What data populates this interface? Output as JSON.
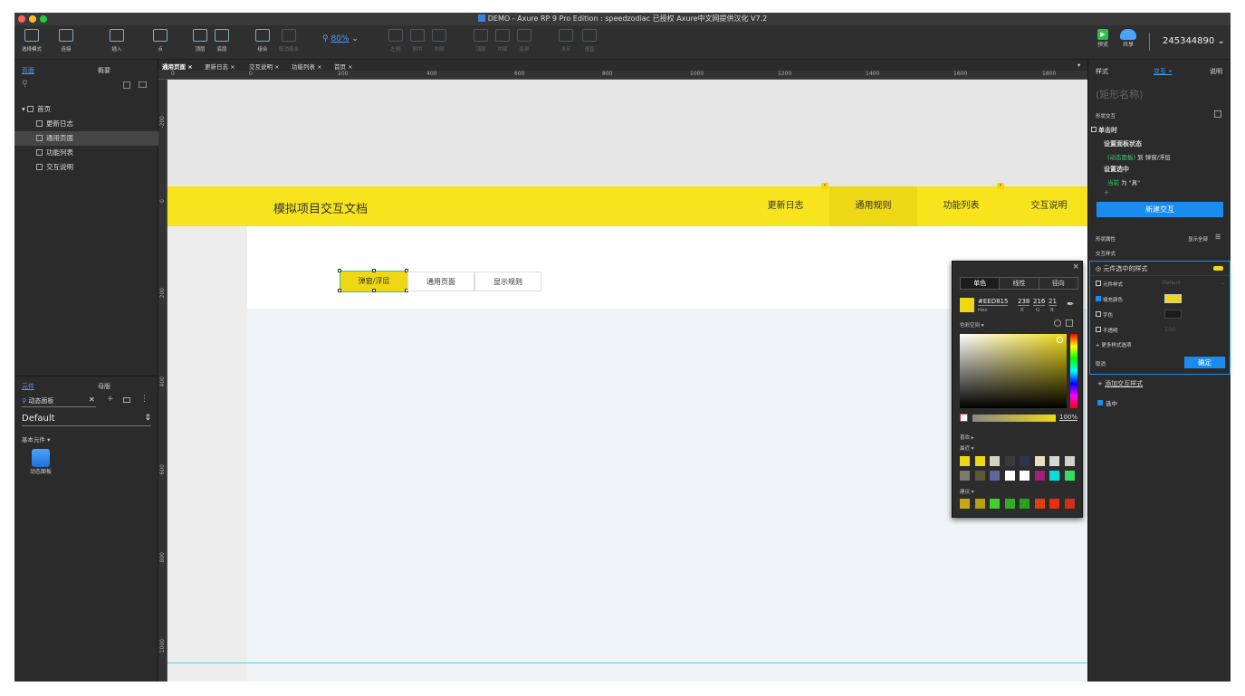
{
  "window": {
    "title": "DEMO - Axure RP 9 Pro Edition : speedzodiac 已授权    Axure中文网提供汉化 V7.2"
  },
  "toolbar": {
    "items": [
      "选择模式",
      "连接",
      "插入",
      "点",
      "顶层",
      "底层",
      "组合",
      "取消组合"
    ],
    "zoom": "80%",
    "disabled_items": [
      "左侧",
      "居中",
      "右侧",
      "顶部",
      "中部",
      "底部",
      "水平",
      "垂直"
    ],
    "preview": "预览",
    "share": "共享",
    "account": "245344890"
  },
  "left_panel": {
    "tabs": [
      "页面",
      "概要"
    ],
    "tree": {
      "root": "首页",
      "children": [
        "更新日志",
        "通用页面",
        "功能列表",
        "交互说明"
      ]
    },
    "lib_tabs": [
      "元件",
      "母版"
    ],
    "search_value": "动态面板",
    "library": "Default",
    "section": "基本元件 ▾",
    "widget_label": "动态面板"
  },
  "doc_tabs": [
    "通用页面",
    "更新日志",
    "交互说明",
    "功能列表",
    "首页"
  ],
  "ruler": {
    "h": [
      "0",
      "200",
      "400",
      "600",
      "800",
      "1000",
      "1200",
      "1400",
      "1600",
      "1800"
    ],
    "v": [
      "-200",
      "0",
      "200",
      "400",
      "600",
      "800",
      "1000"
    ]
  },
  "design": {
    "header_title": "模拟项目交互文档",
    "nav": [
      "更新日志",
      "通用规则",
      "功能列表",
      "交互说明"
    ],
    "sub_tabs": [
      "弹窗/浮层",
      "通用页面",
      "显示规则"
    ],
    "colors": {
      "yellow": "#F7E41C",
      "nav_active": "#EDD815",
      "selected": "#EED815"
    }
  },
  "right_panel": {
    "tabs": [
      "样式",
      "交互 •",
      "说明"
    ],
    "shape_name": "(矩形名称)",
    "section": "形状交互",
    "event": "单击时",
    "action1": "设置面板状态",
    "action1_detail_a": "(动态面板)",
    "action1_detail_b": " 到 弹窗/浮层",
    "action2": "设置选中",
    "action2_detail_a": "当前",
    "action2_detail_b": " 为 \"真\"",
    "new_button": "新建交互",
    "props": "形状属性",
    "show_all": "显示全部",
    "interact_style": "交互样式",
    "selected_style": "元件选中的样式",
    "opt_style": "元件样式",
    "opt_style_val": "Default",
    "opt_fill": "填充颜色",
    "opt_font": "字色",
    "opt_opacity": "不透明",
    "opt_opacity_val": "100",
    "more": "+ 更多样式选项",
    "cancel": "取消",
    "ok": "确定",
    "add_style": "添加交互样式",
    "checked": "选中"
  },
  "color_picker": {
    "tabs": [
      "单色",
      "线性",
      "径向"
    ],
    "hex": "#EED815",
    "hex_label": "Hex",
    "r": "238",
    "g": "216",
    "b": "21",
    "r_label": "R",
    "g_label": "G",
    "b_label": "B",
    "space": "色彩空间 ▾",
    "opacity": "100%",
    "fav": "喜欢 ▸",
    "recent": "最近 ▾",
    "suggest": "建议 ▾",
    "recent_colors": [
      "#EED815",
      "#EED815",
      "#D8D2C0",
      "#3A3A3A",
      "#2C3550",
      "#E8E0C0",
      "#D8D8D0",
      "#D0D0C8",
      "#7A7A6A",
      "#5A5A3A",
      "#5A6A9A",
      "#FFFFFF",
      "#FFFFFF",
      "#A0207A",
      "#00E0E0",
      "#30E060"
    ],
    "suggest_colors": [
      "#C8A816",
      "#B8A010",
      "#40D030",
      "#30B020",
      "#28A020",
      "#E04010",
      "#E83010",
      "#D03018"
    ]
  }
}
